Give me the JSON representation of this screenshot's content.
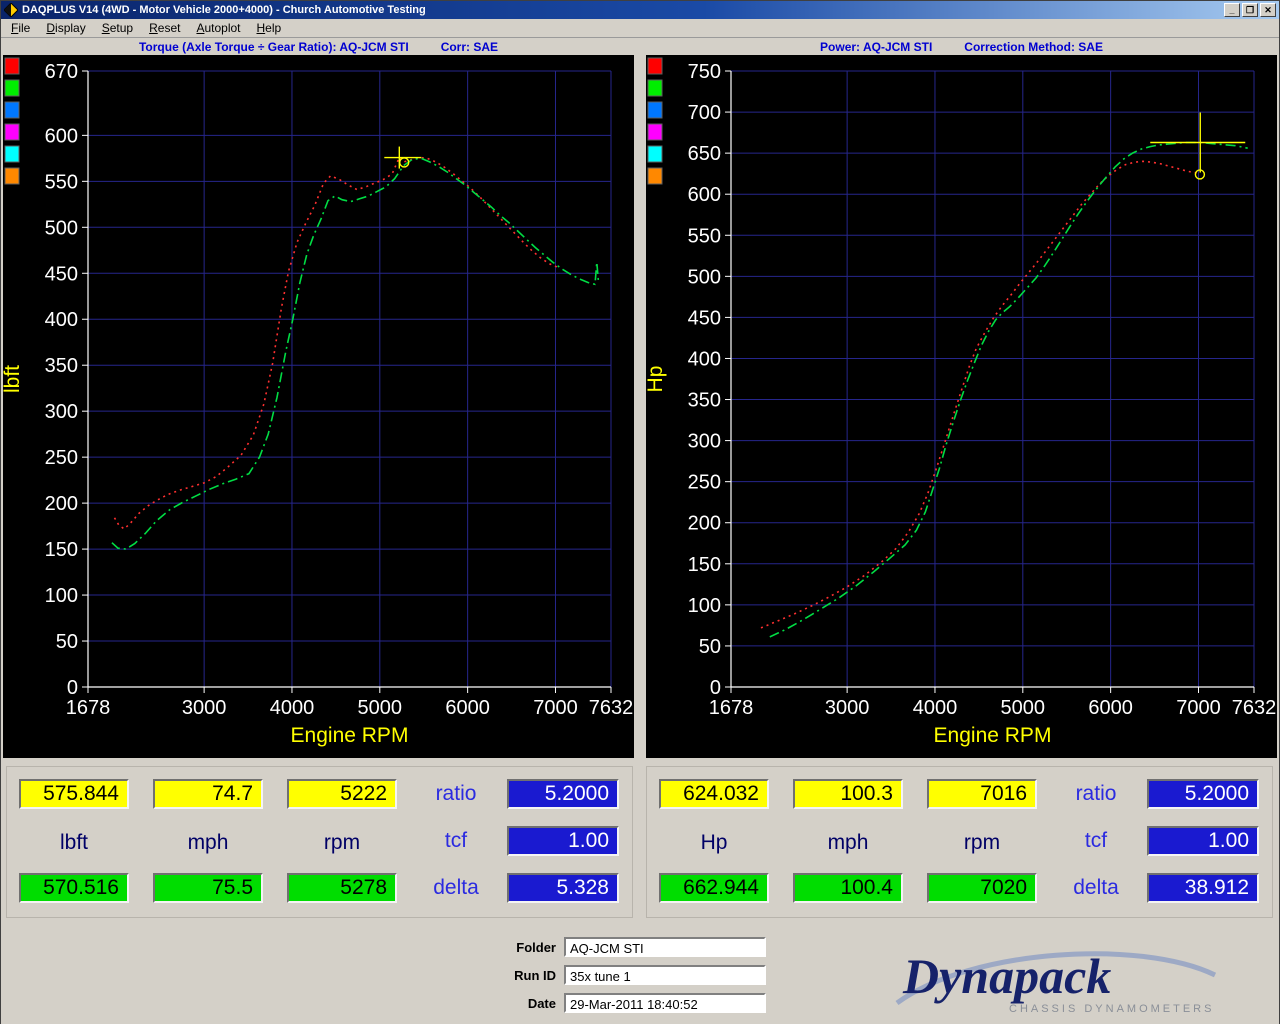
{
  "window": {
    "title": "DAQPLUS V14 (4WD - Motor Vehicle 2000+4000) - Church Automotive Testing",
    "buttons": {
      "minimize": "_",
      "restore": "❐",
      "close": "✕"
    }
  },
  "menu": [
    "File",
    "Display",
    "Setup",
    "Reset",
    "Autoplot",
    "Help"
  ],
  "chart_data": [
    {
      "type": "line",
      "title": "Torque (Axle Torque ÷ Gear Ratio): AQ-JCM STI",
      "corr_label": "Corr: SAE",
      "xlabel": "Engine RPM",
      "ylabel": "lbft",
      "xlim": [
        1678,
        7632
      ],
      "ylim": [
        0,
        670
      ],
      "xticks": [
        1678,
        3000,
        4000,
        5000,
        6000,
        7000,
        7632
      ],
      "yticks": [
        0,
        50,
        100,
        150,
        200,
        250,
        300,
        350,
        400,
        450,
        500,
        550,
        600,
        670
      ],
      "grid": true,
      "legend_colors": [
        "#ff0000",
        "#00ee00",
        "#0077ff",
        "#ff00ff",
        "#00ffff",
        "#ff8800"
      ],
      "series": [
        {
          "name": "run-red",
          "color": "#ff3030",
          "dash": "2 4",
          "points": [
            [
              1980,
              184
            ],
            [
              2030,
              176
            ],
            [
              2090,
              172
            ],
            [
              2160,
              178
            ],
            [
              2260,
              189
            ],
            [
              2360,
              197
            ],
            [
              2460,
              203
            ],
            [
              2580,
              209
            ],
            [
              2720,
              214
            ],
            [
              2860,
              218
            ],
            [
              3000,
              222
            ],
            [
              3140,
              229
            ],
            [
              3280,
              240
            ],
            [
              3420,
              252
            ],
            [
              3560,
              274
            ],
            [
              3680,
              308
            ],
            [
              3780,
              352
            ],
            [
              3880,
              412
            ],
            [
              3960,
              452
            ],
            [
              4060,
              484
            ],
            [
              4160,
              505
            ],
            [
              4260,
              524
            ],
            [
              4360,
              548
            ],
            [
              4440,
              556
            ],
            [
              4540,
              552
            ],
            [
              4640,
              546
            ],
            [
              4740,
              541
            ],
            [
              4840,
              544
            ],
            [
              4940,
              548
            ],
            [
              5040,
              552
            ],
            [
              5140,
              558
            ],
            [
              5222,
              576
            ],
            [
              5270,
              571
            ],
            [
              5340,
              573
            ],
            [
              5440,
              576
            ],
            [
              5540,
              575
            ],
            [
              5640,
              571
            ],
            [
              5740,
              565
            ],
            [
              5840,
              558
            ],
            [
              5940,
              550
            ],
            [
              6040,
              542
            ],
            [
              6140,
              533
            ],
            [
              6240,
              523
            ],
            [
              6340,
              513
            ],
            [
              6440,
              503
            ],
            [
              6540,
              493
            ],
            [
              6640,
              483
            ],
            [
              6740,
              474
            ],
            [
              6840,
              466
            ],
            [
              6940,
              460
            ],
            [
              7040,
              456
            ]
          ]
        },
        {
          "name": "run-green",
          "color": "#00dd44",
          "dash": "10 4 2 4",
          "points": [
            [
              1950,
              157
            ],
            [
              2020,
              151
            ],
            [
              2110,
              150
            ],
            [
              2210,
              156
            ],
            [
              2330,
              167
            ],
            [
              2460,
              181
            ],
            [
              2610,
              193
            ],
            [
              2760,
              201
            ],
            [
              2910,
              208
            ],
            [
              3060,
              215
            ],
            [
              3210,
              221
            ],
            [
              3360,
              226
            ],
            [
              3510,
              232
            ],
            [
              3630,
              250
            ],
            [
              3730,
              275
            ],
            [
              3830,
              315
            ],
            [
              3930,
              365
            ],
            [
              4010,
              400
            ],
            [
              4090,
              440
            ],
            [
              4170,
              471
            ],
            [
              4250,
              492
            ],
            [
              4330,
              509
            ],
            [
              4410,
              529
            ],
            [
              4490,
              534
            ],
            [
              4570,
              530
            ],
            [
              4670,
              528
            ],
            [
              4770,
              531
            ],
            [
              4870,
              534
            ],
            [
              4970,
              539
            ],
            [
              5070,
              544
            ],
            [
              5170,
              553
            ],
            [
              5270,
              567
            ],
            [
              5370,
              574
            ],
            [
              5470,
              575
            ],
            [
              5570,
              571
            ],
            [
              5670,
              566
            ],
            [
              5770,
              560
            ],
            [
              5870,
              553
            ],
            [
              5970,
              546
            ],
            [
              6070,
              538
            ],
            [
              6170,
              530
            ],
            [
              6270,
              522
            ],
            [
              6370,
              513
            ],
            [
              6470,
              505
            ],
            [
              6570,
              496
            ],
            [
              6670,
              487
            ],
            [
              6770,
              478
            ],
            [
              6870,
              470
            ],
            [
              6970,
              462
            ],
            [
              7070,
              455
            ],
            [
              7170,
              449
            ],
            [
              7270,
              444
            ],
            [
              7370,
              440
            ],
            [
              7450,
              438
            ],
            [
              7470,
              462
            ],
            [
              7490,
              440
            ]
          ]
        }
      ],
      "cursor_cross": [
        5222,
        575.844
      ],
      "cursor_circle": [
        5278,
        570.516
      ]
    },
    {
      "type": "line",
      "title": "Power: AQ-JCM STI",
      "corr_label": "Correction Method: SAE",
      "xlabel": "Engine RPM",
      "ylabel": "Hp",
      "xlim": [
        1678,
        7632
      ],
      "ylim": [
        0,
        750
      ],
      "xticks": [
        1678,
        3000,
        4000,
        5000,
        6000,
        7000,
        7632
      ],
      "yticks": [
        0,
        50,
        100,
        150,
        200,
        250,
        300,
        350,
        400,
        450,
        500,
        550,
        600,
        650,
        700,
        750
      ],
      "grid": true,
      "legend_colors": [
        "#ff0000",
        "#00ee00",
        "#0077ff",
        "#ff00ff",
        "#00ffff",
        "#ff8800"
      ],
      "series": [
        {
          "name": "run-red",
          "color": "#ff3030",
          "dash": "2 4",
          "points": [
            [
              2020,
              72
            ],
            [
              2200,
              80
            ],
            [
              2400,
              89
            ],
            [
              2600,
              99
            ],
            [
              2800,
              110
            ],
            [
              3000,
              122
            ],
            [
              3200,
              136
            ],
            [
              3400,
              153
            ],
            [
              3560,
              169
            ],
            [
              3700,
              189
            ],
            [
              3820,
              211
            ],
            [
              3920,
              236
            ],
            [
              4010,
              264
            ],
            [
              4110,
              297
            ],
            [
              4210,
              331
            ],
            [
              4310,
              364
            ],
            [
              4390,
              390
            ],
            [
              4470,
              412
            ],
            [
              4570,
              432
            ],
            [
              4670,
              450
            ],
            [
              4770,
              465
            ],
            [
              4870,
              478
            ],
            [
              4970,
              492
            ],
            [
              5070,
              505
            ],
            [
              5170,
              518
            ],
            [
              5270,
              532
            ],
            [
              5370,
              546
            ],
            [
              5470,
              560
            ],
            [
              5570,
              574
            ],
            [
              5670,
              588
            ],
            [
              5770,
              600
            ],
            [
              5870,
              612
            ],
            [
              5970,
              622
            ],
            [
              6070,
              630
            ],
            [
              6170,
              636
            ],
            [
              6270,
              639
            ],
            [
              6370,
              640
            ],
            [
              6470,
              639
            ],
            [
              6570,
              637
            ],
            [
              6670,
              634
            ],
            [
              6770,
              631
            ],
            [
              6870,
              628
            ],
            [
              6970,
              626
            ],
            [
              7016,
              624
            ]
          ]
        },
        {
          "name": "run-green",
          "color": "#00dd44",
          "dash": "10 4 2 4",
          "points": [
            [
              2120,
              61
            ],
            [
              2300,
              70
            ],
            [
              2500,
              82
            ],
            [
              2700,
              95
            ],
            [
              2900,
              108
            ],
            [
              3100,
              123
            ],
            [
              3300,
              140
            ],
            [
              3500,
              158
            ],
            [
              3660,
              173
            ],
            [
              3790,
              191
            ],
            [
              3890,
              213
            ],
            [
              3970,
              239
            ],
            [
              4050,
              266
            ],
            [
              4130,
              296
            ],
            [
              4210,
              323
            ],
            [
              4290,
              349
            ],
            [
              4370,
              373
            ],
            [
              4450,
              395
            ],
            [
              4530,
              416
            ],
            [
              4610,
              433
            ],
            [
              4690,
              447
            ],
            [
              4770,
              456
            ],
            [
              4850,
              463
            ],
            [
              4950,
              474
            ],
            [
              5050,
              486
            ],
            [
              5150,
              498
            ],
            [
              5250,
              513
            ],
            [
              5350,
              529
            ],
            [
              5450,
              546
            ],
            [
              5550,
              563
            ],
            [
              5650,
              579
            ],
            [
              5750,
              594
            ],
            [
              5850,
              608
            ],
            [
              5950,
              621
            ],
            [
              6050,
              633
            ],
            [
              6150,
              643
            ],
            [
              6250,
              650
            ],
            [
              6350,
              655
            ],
            [
              6450,
              658
            ],
            [
              6550,
              660
            ],
            [
              6650,
              661
            ],
            [
              6750,
              662
            ],
            [
              6850,
              663
            ],
            [
              6950,
              663
            ],
            [
              7020,
              663
            ],
            [
              7120,
              662
            ],
            [
              7220,
              661
            ],
            [
              7320,
              660
            ],
            [
              7420,
              659
            ],
            [
              7520,
              657
            ],
            [
              7560,
              656
            ]
          ]
        }
      ],
      "cursor_cross": [
        7020,
        662.944
      ],
      "cursor_circle": [
        7016,
        624.032
      ]
    }
  ],
  "readouts": [
    {
      "yellow": [
        "575.844",
        "74.7",
        "5222"
      ],
      "units": [
        "lbft",
        "mph",
        "rpm"
      ],
      "green": [
        "570.516",
        "75.5",
        "5278"
      ],
      "labels": {
        "ratio": "ratio",
        "tcf": "tcf",
        "delta": "delta"
      },
      "blue": {
        "ratio": "5.2000",
        "tcf": "1.00",
        "delta": "5.328"
      }
    },
    {
      "yellow": [
        "624.032",
        "100.3",
        "7016"
      ],
      "units": [
        "Hp",
        "mph",
        "rpm"
      ],
      "green": [
        "662.944",
        "100.4",
        "7020"
      ],
      "labels": {
        "ratio": "ratio",
        "tcf": "tcf",
        "delta": "delta"
      },
      "blue": {
        "ratio": "5.2000",
        "tcf": "1.00",
        "delta": "38.912"
      }
    }
  ],
  "footer": {
    "fields": [
      {
        "label": "Folder",
        "value": "AQ-JCM STI"
      },
      {
        "label": "Run ID",
        "value": "35x tune 1"
      },
      {
        "label": "Date",
        "value": "29-Mar-2011 18:40:52"
      }
    ],
    "logo_text": "Dynapack",
    "logo_sub": "CHASSIS   DYNAMOMETERS"
  }
}
